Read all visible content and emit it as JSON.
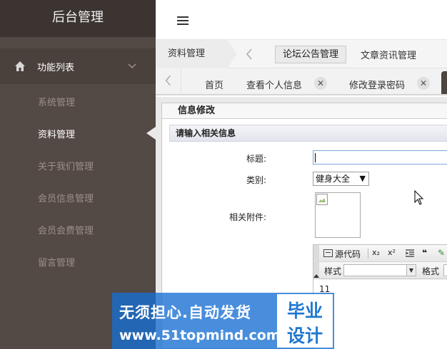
{
  "sidebar": {
    "title": "后台管理",
    "group_label": "功能列表",
    "items": [
      {
        "label": "系统管理"
      },
      {
        "label": "资料管理"
      },
      {
        "label": "关于我们管理"
      },
      {
        "label": "会员信息管理"
      },
      {
        "label": "会员会费管理"
      },
      {
        "label": "留言管理"
      }
    ],
    "active_index": 1
  },
  "topbar": {
    "menu_icon": "hamburger-icon"
  },
  "breadcrumb": {
    "current": "资料管理",
    "modules": [
      "论坛公告管理",
      "文章资讯管理"
    ],
    "active_module": "论坛公告管理"
  },
  "tabs": [
    {
      "label": "首页",
      "closable": false
    },
    {
      "label": "查看个人信息",
      "closable": true
    },
    {
      "label": "修改登录密码",
      "closable": true
    }
  ],
  "tab_close_glyph": "✕",
  "panel": {
    "title": "信息修改",
    "section": "请输入相关信息",
    "fields": {
      "title_label": "标题:",
      "title_value": "",
      "category_label": "类别:",
      "category_value": "健身大全",
      "attachment_label": "相关附件:"
    }
  },
  "editor": {
    "source_label": "源代码",
    "subscript": "x₂",
    "superscript": "x²",
    "quote": "❝",
    "style_label": "样式",
    "format_label": "格式",
    "content": "11"
  },
  "watermark": {
    "line1": "无须担心.自动发货",
    "line2": "www.51topmind.com",
    "badge_top": "毕业",
    "badge_bottom": "设计"
  },
  "colors": {
    "sidebar_bg": "#534945",
    "sidebar_title_bg": "#3c3431",
    "watermark_bg": "#166ed2",
    "badge_text": "#1f77d0"
  }
}
